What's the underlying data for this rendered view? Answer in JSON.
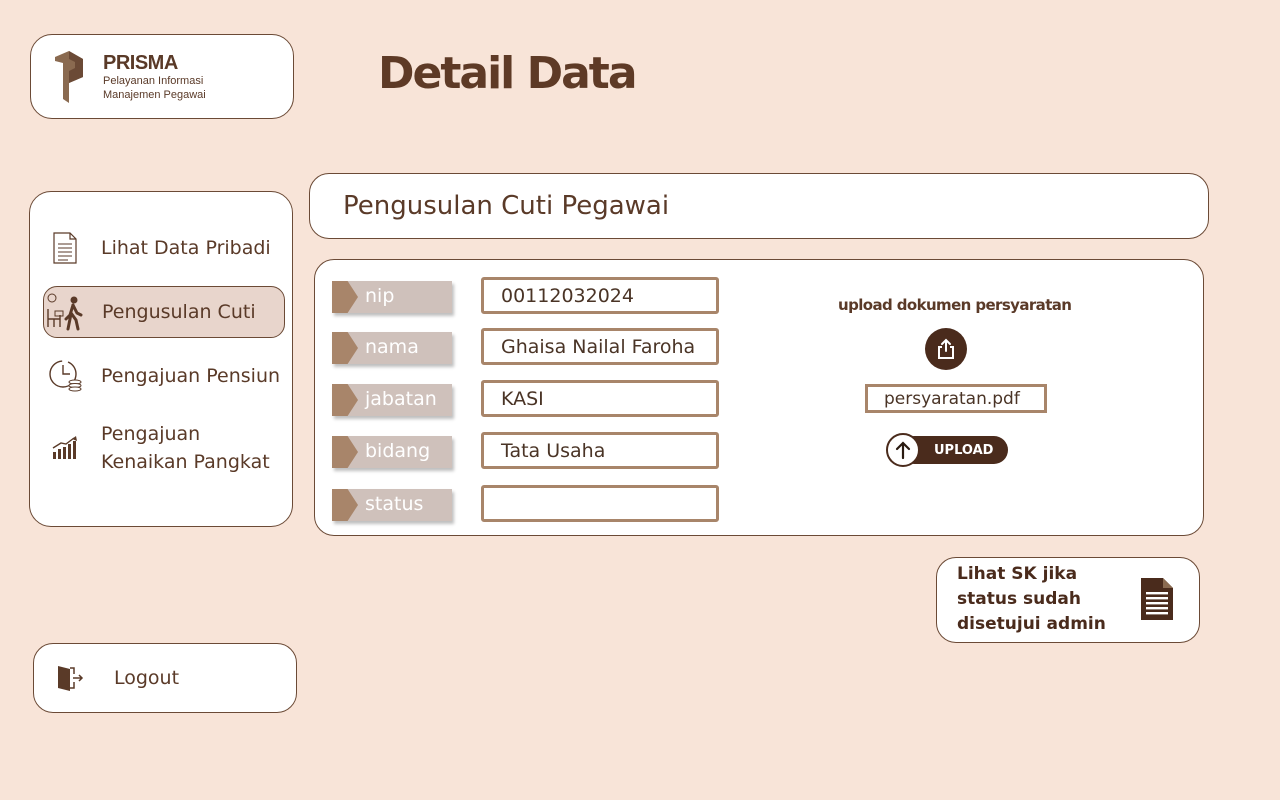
{
  "app": {
    "brand": "PRISMA",
    "tagline_line1": "Pelayanan Informasi",
    "tagline_line2": "Manajemen Pegawai"
  },
  "page": {
    "title": "Detail Data"
  },
  "sidebar": {
    "items": [
      {
        "label": "Lihat Data Pribadi",
        "icon": "document-icon",
        "active": false
      },
      {
        "label": "Pengusulan Cuti",
        "icon": "leave-walking-icon",
        "active": true
      },
      {
        "label": "Pengajuan Pensiun",
        "icon": "clock-coins-icon",
        "active": false
      },
      {
        "label": "Pengajuan Kenaikan Pangkat",
        "icon": "growth-chart-icon",
        "active": false
      }
    ]
  },
  "logout": {
    "label": "Logout",
    "icon": "exit-door-icon"
  },
  "section": {
    "title": "Pengusulan Cuti Pegawai"
  },
  "form": {
    "fields": [
      {
        "label": "nip",
        "value": "00112032024"
      },
      {
        "label": "nama",
        "value": "Ghaisa Nailal Faroha"
      },
      {
        "label": "jabatan",
        "value": "KASI"
      },
      {
        "label": "bidang",
        "value": "Tata Usaha"
      },
      {
        "label": "status",
        "value": ""
      }
    ]
  },
  "upload": {
    "title": "upload dokumen persyaratan",
    "filename": "persyaratan.pdf",
    "button_label": "UPLOAD"
  },
  "sk_card": {
    "text": "Lihat SK jika status sudah disetujui admin"
  },
  "colors": {
    "background": "#f8e4d8",
    "primary_brown": "#5a3a28",
    "dark_brown": "#4a2b1c",
    "accent_tan": "#a8856a",
    "label_bg": "#cfc1bb",
    "active_nav": "#e8d5cc"
  }
}
